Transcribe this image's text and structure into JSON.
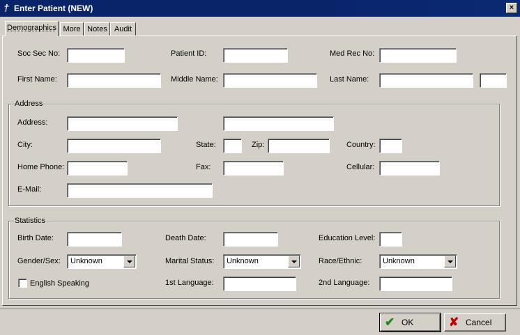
{
  "window": {
    "title": "Enter Patient (NEW)",
    "close_glyph": "×",
    "icon_glyph": "†"
  },
  "tabs": [
    "Demographics",
    "More",
    "Notes",
    "Audit"
  ],
  "demographics": {
    "ssn_label": "Soc Sec No:",
    "patient_id_label": "Patient ID:",
    "med_rec_label": "Med Rec No:",
    "first_name_label": "First Name:",
    "middle_name_label": "Middle Name:",
    "last_name_label": "Last Name:"
  },
  "address": {
    "group_label": "Address",
    "address_label": "Address:",
    "city_label": "City:",
    "state_label": "State:",
    "zip_label": "Zip:",
    "country_label": "Country:",
    "home_phone_label": "Home Phone:",
    "fax_label": "Fax:",
    "cellular_label": "Cellular:",
    "email_label": "E-Mail:"
  },
  "statistics": {
    "group_label": "Statistics",
    "birth_date_label": "Birth Date:",
    "death_date_label": "Death Date:",
    "education_label": "Education Level:",
    "gender_label": "Gender/Sex:",
    "gender_value": "Unknown",
    "marital_label": "Marital Status:",
    "marital_value": "Unknown",
    "race_label": "Race/Ethnic:",
    "race_value": "Unknown",
    "english_label": "English Speaking",
    "english_checked": false,
    "first_lang_label": "1st Language:",
    "second_lang_label": "2nd Language:"
  },
  "buttons": {
    "ok_label": "OK",
    "ok_icon": "checkmark-icon",
    "cancel_label": "Cancel",
    "cancel_icon": "x-mark-icon",
    "ok_color": "#1a8a1a",
    "cancel_color": "#c00000"
  }
}
